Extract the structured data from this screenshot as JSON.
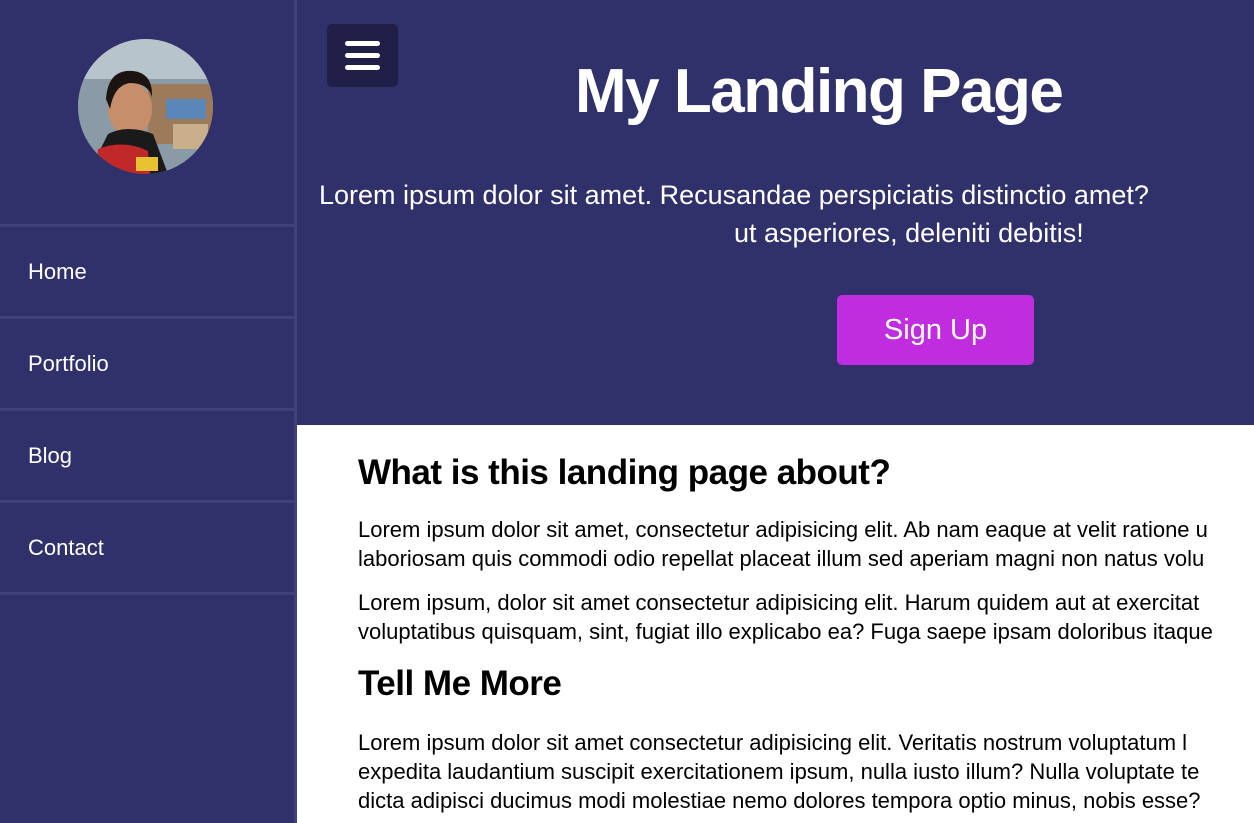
{
  "sidebar": {
    "avatar_alt": "profile photo",
    "items": [
      {
        "label": "Home"
      },
      {
        "label": "Portfolio"
      },
      {
        "label": "Blog"
      },
      {
        "label": "Contact"
      }
    ]
  },
  "hero": {
    "menu_icon": "hamburger-menu-icon",
    "title": "My Landing Page",
    "text_line1": "Lorem ipsum dolor sit amet. Recusandae perspiciatis distinctio amet?",
    "text_line2": "ut asperiores, deleniti debitis!",
    "signup_label": "Sign Up"
  },
  "content": {
    "heading_about": "What is this landing page about?",
    "para1_line1": "Lorem ipsum dolor sit amet, consectetur adipisicing elit. Ab nam eaque at velit ratione u",
    "para1_line2": "laboriosam quis commodi odio repellat placeat illum sed aperiam magni non natus volu",
    "para2_line1": "Lorem ipsum, dolor sit amet consectetur adipisicing elit. Harum quidem aut at exercitat",
    "para2_line2": "voluptatibus quisquam, sint, fugiat illo explicabo ea? Fuga saepe ipsam doloribus itaque",
    "heading_more": "Tell Me More",
    "para3_line1": "Lorem ipsum dolor sit amet consectetur adipisicing elit. Veritatis nostrum voluptatum l",
    "para3_line2": "expedita laudantium suscipit exercitationem ipsum, nulla iusto illum? Nulla voluptate te",
    "para3_line3": "dicta adipisci ducimus modi molestiae nemo dolores tempora optio minus, nobis esse?"
  },
  "colors": {
    "sidebar_bg": "#30306b",
    "hero_bg": "#30306b",
    "menu_button_bg": "#1f1f47",
    "signup_bg": "#c02ddf",
    "text_light": "#ffffff",
    "text_dark": "#000000"
  }
}
